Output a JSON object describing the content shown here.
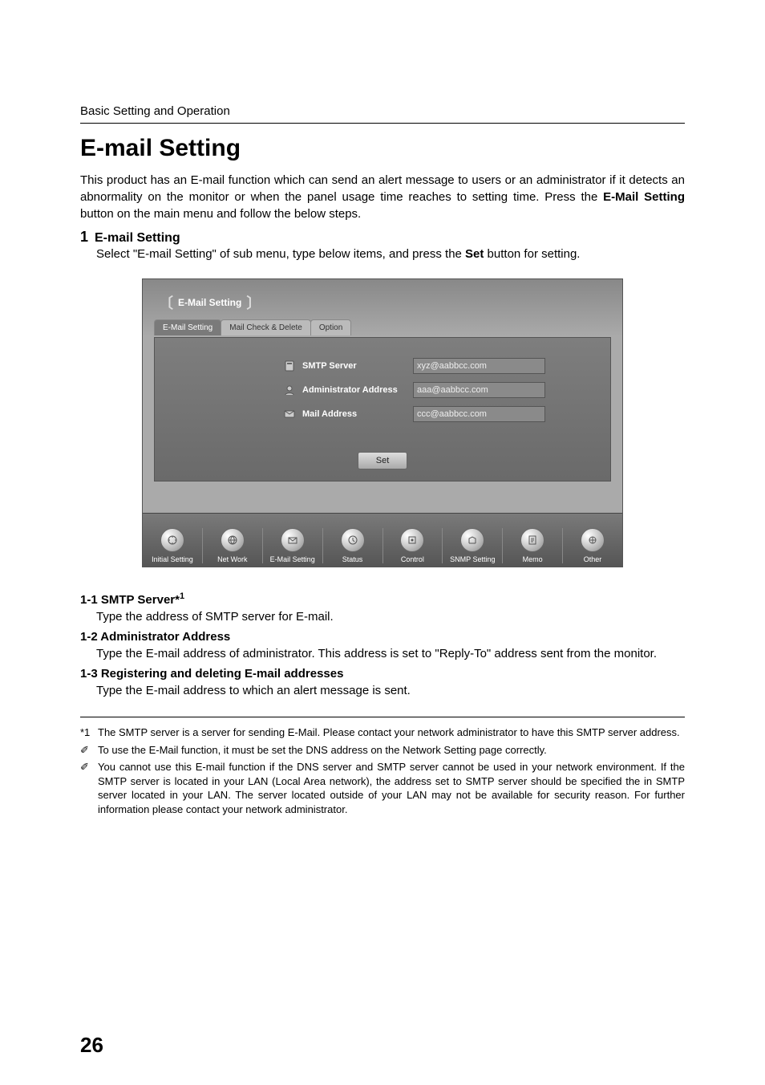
{
  "header": "Basic Setting and Operation",
  "title": "E-mail Setting",
  "intro": {
    "part1": "This product has an E-mail function which can send an alert message to users or an administrator if it detects an abnormality on the monitor or when the panel usage time reaches to setting time. Press the ",
    "bold": "E-Mail Setting",
    "part2": " button on the main menu and follow the below steps."
  },
  "step1": {
    "num": "1",
    "head": "E-mail Setting",
    "text_part1": "Select \"E-mail Setting\" of sub menu, type below items, and press the ",
    "text_bold": "Set",
    "text_part2": " button for setting."
  },
  "screenshot": {
    "title": "E-Mail Setting",
    "tabs": [
      "E-Mail Setting",
      "Mail Check & Delete",
      "Option"
    ],
    "active_tab_index": 0,
    "fields": [
      {
        "label": "SMTP Server",
        "value": "xyz@aabbcc.com"
      },
      {
        "label": "Administrator Address",
        "value": "aaa@aabbcc.com"
      },
      {
        "label": "Mail Address",
        "value": "ccc@aabbcc.com"
      }
    ],
    "set_button": "Set",
    "nav": [
      "Initial Setting",
      "Net Work",
      "E-Mail Setting",
      "Status",
      "Control",
      "SNMP Setting",
      "Memo",
      "Other"
    ]
  },
  "items": {
    "i11_head": "1-1 SMTP Server*",
    "i11_sup": "1",
    "i11_text": "Type the address of SMTP server for E-mail.",
    "i12_head": "1-2 Administrator Address",
    "i12_text": "Type the E-mail address of administrator. This address is set to \"Reply-To\" address sent from the monitor.",
    "i13_head": "1-3 Registering and deleting E-mail addresses",
    "i13_text": "Type the E-mail address to which an alert message is sent."
  },
  "footnotes": {
    "f1_mark": "*1",
    "f1_text": "The SMTP server is a server for sending E-Mail. Please contact your network administrator to have this SMTP server address.",
    "f2_mark": "✐",
    "f2_text": "To use the E-Mail function, it must be set the DNS address on the Network Setting page correctly.",
    "f3_mark": "✐",
    "f3_text": "You cannot use this E-mail function if the DNS server and SMTP server cannot be used in your network environment. If the SMTP server is located in your LAN (Local Area network), the address set to SMTP server should be specified the in SMTP server located in your LAN. The server located outside of your LAN may not be available for security reason. For further information please contact your network administrator."
  },
  "page_number": "26"
}
